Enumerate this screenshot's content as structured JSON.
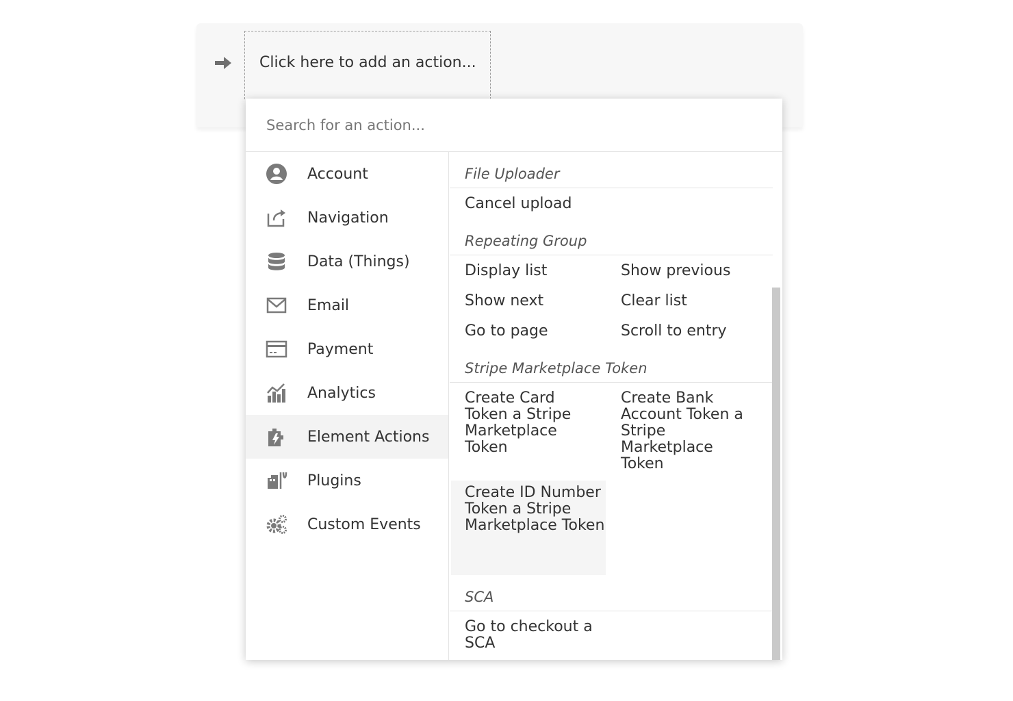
{
  "workflow": {
    "add_action_label": "Click here to add an action..."
  },
  "search": {
    "placeholder": "Search for an action..."
  },
  "categories": [
    {
      "label": "Account",
      "icon": "account-icon"
    },
    {
      "label": "Navigation",
      "icon": "navigation-icon"
    },
    {
      "label": "Data (Things)",
      "icon": "database-icon"
    },
    {
      "label": "Email",
      "icon": "email-icon"
    },
    {
      "label": "Payment",
      "icon": "credit-card-icon"
    },
    {
      "label": "Analytics",
      "icon": "analytics-icon"
    },
    {
      "label": "Element Actions",
      "icon": "element-actions-icon",
      "active": true
    },
    {
      "label": "Plugins",
      "icon": "plugins-icon"
    },
    {
      "label": "Custom Events",
      "icon": "gears-icon"
    }
  ],
  "groups": [
    {
      "title": "File Uploader",
      "actions": [
        "Cancel upload"
      ]
    },
    {
      "title": "Repeating Group",
      "actions": [
        "Display list",
        "Show previous",
        "Show next",
        "Clear list",
        "Go to page",
        "Scroll to entry"
      ]
    },
    {
      "title": "Stripe Marketplace Token",
      "actions": [
        "Create Card Token a Stripe Marketplace Token",
        "Create Bank Account Token a Stripe Marketplace Token",
        "Create ID Number Token a Stripe Marketplace Token"
      ]
    },
    {
      "title": "SCA",
      "actions": [
        "Go to checkout a SCA"
      ]
    }
  ],
  "colors": {
    "panel_bg": "#f7f7f7",
    "icon_gray": "#7a7a7a",
    "active_bg": "#f3f3f3",
    "scrollbar": "#c9c9c9"
  }
}
